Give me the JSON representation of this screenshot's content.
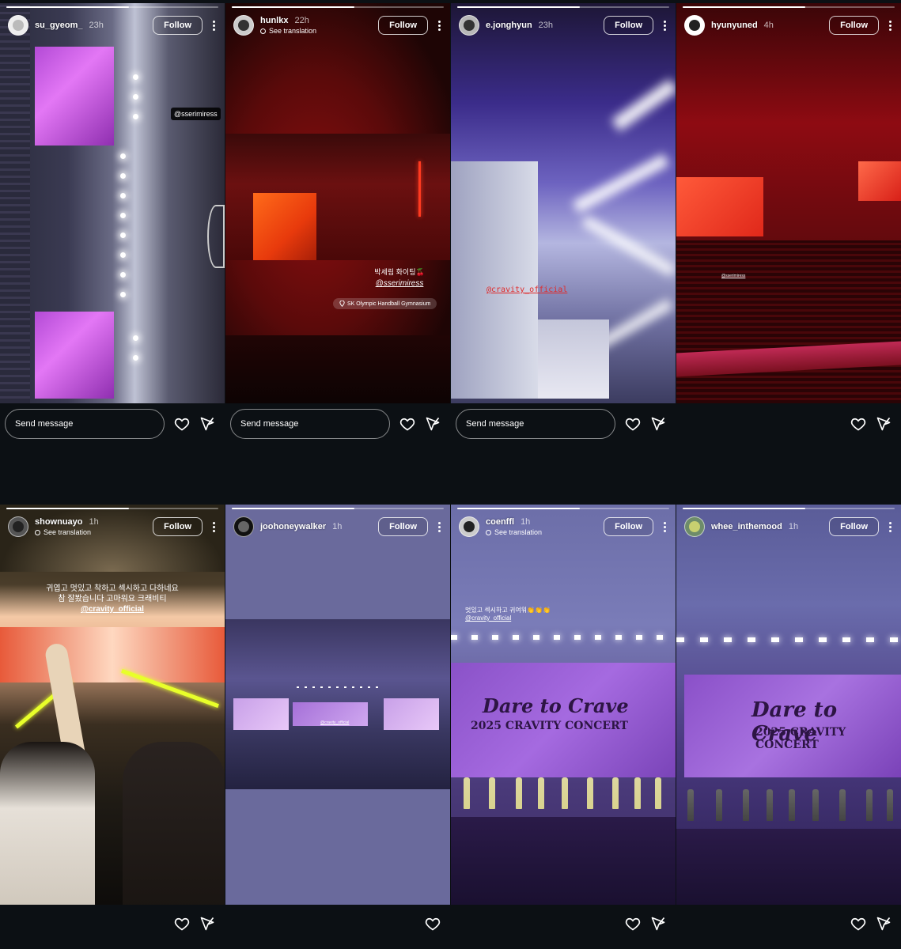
{
  "stories": [
    {
      "username": "su_gyeom_",
      "time": "23h",
      "follow": "Follow",
      "translation": "",
      "message": "Send message",
      "tag": "@sserimiress"
    },
    {
      "username": "hunlkx",
      "time": "22h",
      "follow": "Follow",
      "translation": "See translation",
      "message": "Send message",
      "caption": "박세림 화이팅🍒",
      "tag": "@sserimiress",
      "location": "SK Olympic Handball Gymnasium"
    },
    {
      "username": "e.jonghyun",
      "time": "23h",
      "follow": "Follow",
      "translation": "",
      "message": "Send message",
      "tag": "@cravity_official"
    },
    {
      "username": "hyunyuned",
      "time": "4h",
      "follow": "Follow",
      "translation": "",
      "message": "",
      "tag": "@sserimiress"
    },
    {
      "username": "shownuayo",
      "time": "1h",
      "follow": "Follow",
      "translation": "See translation",
      "message": "",
      "caption1": "귀엽고 멋있고 착하고 섹시하고 다하네요",
      "caption2": "참 잘봤습니다 고마워요 크래비티",
      "tag": "@cravity_official"
    },
    {
      "username": "joohoneywalker",
      "time": "1h",
      "follow": "Follow",
      "translation": "",
      "message": "",
      "tag": "@cravity_official"
    },
    {
      "username": "coenffl",
      "time": "1h",
      "follow": "Follow",
      "translation": "See translation",
      "message": "",
      "caption": "멋있고 섹시하고 귀여워👏👏👏",
      "tag": "@cravity_official",
      "concert_title": "Dare to Crave",
      "concert_sub": "2025 CRAVITY CONCERT"
    },
    {
      "username": "whee_inthemood",
      "time": "1h",
      "follow": "Follow",
      "translation": "",
      "message": "",
      "concert_title": "Dare to Crave",
      "concert_sub": "2025 CRAVITY CONCERT"
    }
  ],
  "icons": {
    "like": "heart-icon",
    "share": "send-icon",
    "more": "more-vertical-icon",
    "location": "location-pin-icon"
  }
}
